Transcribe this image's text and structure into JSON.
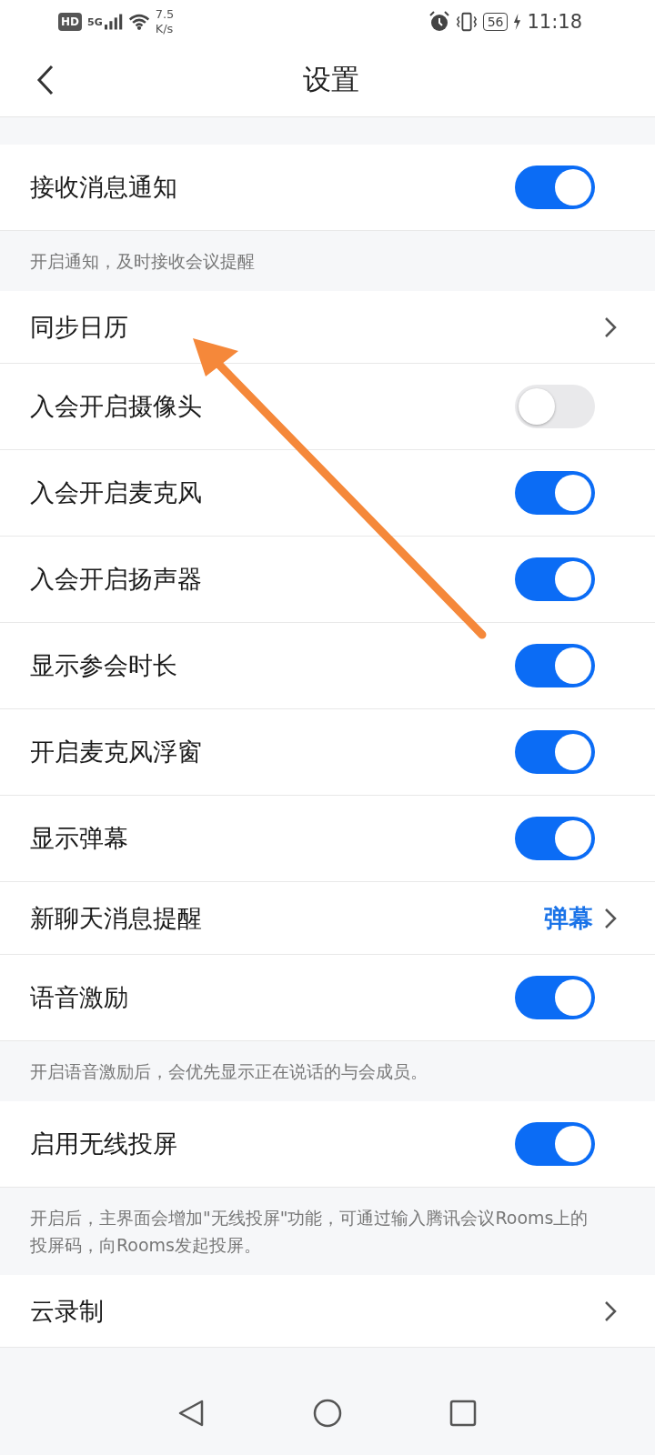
{
  "status_bar": {
    "hd": "HD",
    "network": "5G",
    "speed_value": "7.5",
    "speed_unit": "K/s",
    "battery": "56",
    "time": "11:18"
  },
  "header": {
    "title": "设置"
  },
  "items": [
    {
      "kind": "toggle",
      "label": "接收消息通知",
      "on": true
    },
    {
      "kind": "note",
      "text": "开启通知，及时接收会议提醒"
    },
    {
      "kind": "link",
      "label": "同步日历"
    },
    {
      "kind": "toggle",
      "label": "入会开启摄像头",
      "on": false
    },
    {
      "kind": "toggle",
      "label": "入会开启麦克风",
      "on": true
    },
    {
      "kind": "toggle",
      "label": "入会开启扬声器",
      "on": true
    },
    {
      "kind": "toggle",
      "label": "显示参会时长",
      "on": true
    },
    {
      "kind": "toggle",
      "label": "开启麦克风浮窗",
      "on": true
    },
    {
      "kind": "toggle",
      "label": "显示弹幕",
      "on": true
    },
    {
      "kind": "link",
      "label": "新聊天消息提醒",
      "value": "弹幕"
    },
    {
      "kind": "toggle",
      "label": "语音激励",
      "on": true
    },
    {
      "kind": "note",
      "text": "开启语音激励后，会优先显示正在说话的与会成员。"
    },
    {
      "kind": "toggle",
      "label": "启用无线投屏",
      "on": true
    },
    {
      "kind": "note",
      "text": "开启后，主界面会增加\"无线投屏\"功能，可通过输入腾讯会议Rooms上的投屏码，向Rooms发起投屏。"
    },
    {
      "kind": "link",
      "label": "云录制"
    }
  ],
  "annotation": {
    "kind": "arrow"
  }
}
